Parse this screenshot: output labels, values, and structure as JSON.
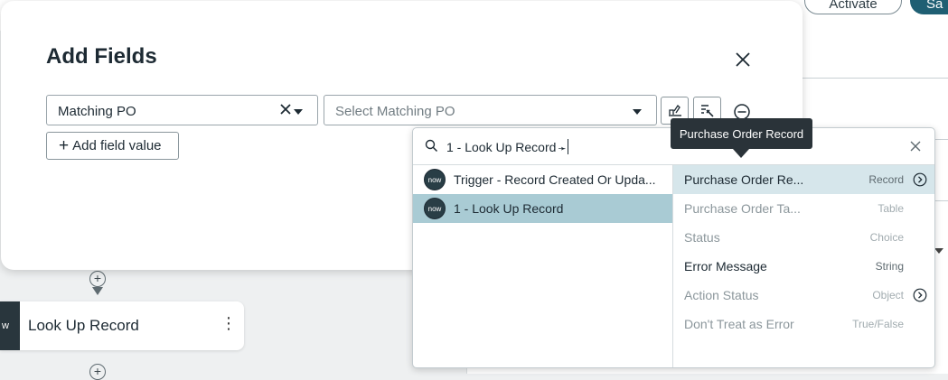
{
  "background": {
    "activate_label": "Activate",
    "save_label": "Sa",
    "step_card": {
      "logo_text": "w",
      "title": "Look Up Record",
      "menu_glyph": "⋮"
    },
    "plus_glyph": "+"
  },
  "modal": {
    "title": "Add Fields",
    "field": {
      "selected": "Matching PO"
    },
    "value": {
      "placeholder": "Select Matching PO"
    },
    "add_field_value_label": "Add field value",
    "add_glyph": "+"
  },
  "picker": {
    "search_value": "1 - Look Up Record",
    "search_arrow": "➛",
    "steps": [
      {
        "label": "Trigger - Record Created Or Upda...",
        "logo": "now",
        "selected": false
      },
      {
        "label": "1 - Look Up Record",
        "logo": "now",
        "selected": true
      }
    ],
    "properties": [
      {
        "name": "Purchase Order Re...",
        "type": "Record",
        "state": "selected",
        "expandable": true
      },
      {
        "name": "Purchase Order Ta...",
        "type": "Table",
        "state": "disabled",
        "expandable": false
      },
      {
        "name": "Status",
        "type": "Choice",
        "state": "disabled",
        "expandable": false
      },
      {
        "name": "Error Message",
        "type": "String",
        "state": "enabled",
        "expandable": false
      },
      {
        "name": "Action Status",
        "type": "Object",
        "state": "disabled",
        "expandable": true
      },
      {
        "name": "Don't Treat as Error",
        "type": "True/False",
        "state": "disabled",
        "expandable": false
      }
    ]
  },
  "tooltip": {
    "text": "Purchase Order Record"
  },
  "colors": {
    "selected_step_bg": "#a9cbd4",
    "selected_prop_bg": "#d6e6eb",
    "tooltip_bg": "#2a3339",
    "primary_button": "#1f5f73"
  },
  "icons": {
    "modal_close": "close-icon",
    "clear": "clear-x-icon",
    "dropdown": "caret-down-icon",
    "data_pill_picker": "data-pill-picker-icon",
    "script": "script-toggle-icon",
    "remove": "minus-circle-icon",
    "search": "search-icon",
    "expand": "chevron-right-circle-icon"
  }
}
